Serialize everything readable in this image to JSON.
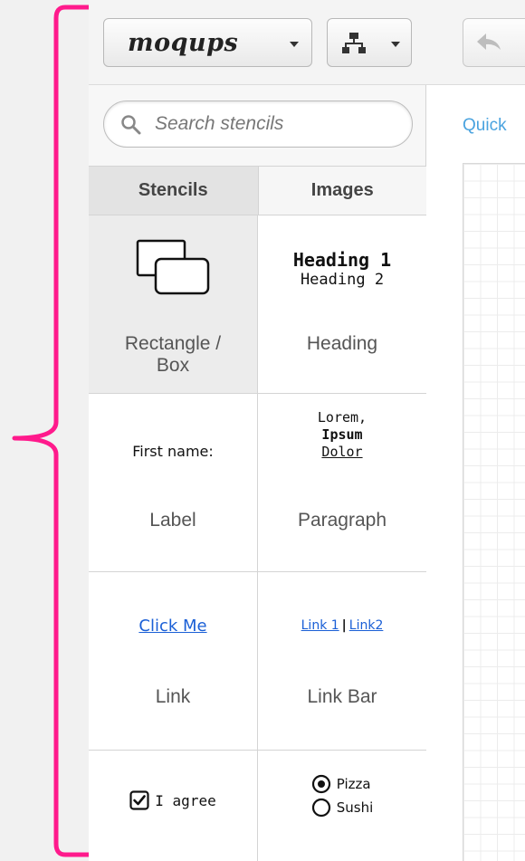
{
  "app": {
    "logo": "moqups"
  },
  "search": {
    "placeholder": "Search stencils"
  },
  "tabs": [
    {
      "label": "Stencils",
      "active": true
    },
    {
      "label": "Images",
      "active": false
    }
  ],
  "stencils": {
    "rectangle": {
      "label": "Rectangle / Box",
      "label_line1": "Rectangle /",
      "label_line2": "Box"
    },
    "heading": {
      "label": "Heading",
      "preview_h1": "Heading 1",
      "preview_h2": "Heading 2"
    },
    "label": {
      "label": "Label",
      "preview": "First name:"
    },
    "paragraph": {
      "label": "Paragraph",
      "preview_line1": "Lorem,",
      "preview_line2": "Ipsum",
      "preview_line3": "Dolor"
    },
    "link": {
      "label": "Link",
      "preview": "Click Me"
    },
    "linkbar": {
      "label": "Link Bar",
      "preview_link1": "Link 1",
      "preview_sep": "|",
      "preview_link2": "Link2"
    },
    "checkbox": {
      "preview": "I agree",
      "checked": true
    },
    "radio": {
      "option1": "Pizza",
      "option2": "Sushi",
      "selected": "Pizza"
    }
  },
  "canvas": {
    "quick_link": "Quick"
  },
  "colors": {
    "bracket": "#ff1a8c",
    "link": "#1a5fd6",
    "quick_link": "#4aa3df"
  }
}
